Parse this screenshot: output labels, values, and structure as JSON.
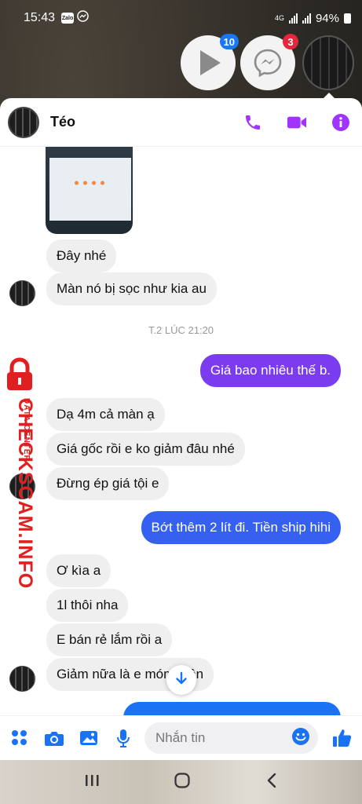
{
  "status_bar": {
    "time": "15:43",
    "app_icon_1": "Zalo",
    "app_icon_2": "messenger-icon",
    "network": "4G",
    "battery": "94%"
  },
  "chat_heads": {
    "play_badge": "10",
    "messenger_badge": "3"
  },
  "header": {
    "contact_name": "Téo",
    "accent_color": "#a033ff"
  },
  "messages": {
    "m1": "Đây nhé",
    "m2": "Màn nó bị sọc như kia au",
    "timestamp": "T.2 LÚC 21:20",
    "m3": "Giá bao nhiêu thế b.",
    "m4": "Dạ 4m cả màn ạ",
    "m5": "Giá gốc rồi e ko giảm đâu nhé",
    "m6": "Đừng ép giá tội e",
    "m7": "Bớt thêm 2 lít đi. Tiền ship hihi",
    "m8": "Ơ kìa a",
    "m9": "1l thôi nha",
    "m10": "E bán rẻ lắm rồi a",
    "m11": "Giảm nữa là e móm luân"
  },
  "watermark": {
    "brand": "CHECKSCAM.INFO",
    "sub": "DATA CENTER"
  },
  "composer": {
    "placeholder": "Nhắn tin"
  },
  "colors": {
    "purple_bubble": "#7b3cf0",
    "blue_bubble": "#3660f0",
    "messenger_blue": "#1a73f5"
  }
}
